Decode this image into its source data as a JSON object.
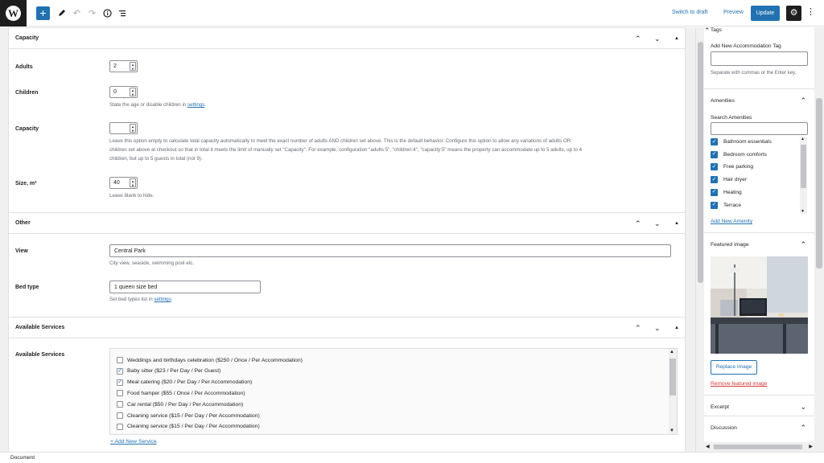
{
  "toolbar": {
    "add_block": "+",
    "switch_to_draft": "Switch to draft",
    "preview": "Preview",
    "update": "Update",
    "icons": [
      "wordpress-logo",
      "plus-icon",
      "pencil-icon",
      "undo-icon",
      "redo-icon",
      "info-icon",
      "list-view-icon",
      "gear-icon",
      "more-vertical-icon"
    ]
  },
  "capacity_section": {
    "title": "Capacity",
    "fields": {
      "adults_label": "Adults",
      "adults_value": "2",
      "children_label": "Children",
      "children_value": "0",
      "children_help_prefix": "State the age or disable children in",
      "children_help_link": "settings",
      "children_help_suffix": ".",
      "capacity_label": "Capacity",
      "capacity_value": "",
      "capacity_help_line1": "Leave this option empty to calculate total capacity automatically to meet the exact number of adults AND children set above. This is the default behavior. Configure this option to allow any variations of adults OR",
      "capacity_help_line2": "children set above at checkout so that in total it meets the limit of manually set \"Capacity\". For example, configuration \"adults:5\", \"children:4\", \"capacity:5\" means the property can accommodate up to 5 adults, up to 4",
      "capacity_help_line3": "children, but up to 5 guests in total (not 9).",
      "size_label": "Size, m²",
      "size_value": "40",
      "size_help": "Leave blank to hide."
    }
  },
  "other_section": {
    "title": "Other",
    "view_label": "View",
    "view_value": "Central Park",
    "view_help": "City view, seaside, swimming pool etc.",
    "bed_label": "Bed type",
    "bed_value": "1 queen size bed",
    "bed_help_prefix": "Set bed types list in",
    "bed_help_link": "settings",
    "bed_help_suffix": "."
  },
  "services_section": {
    "title": "Available Services",
    "label": "Available Services",
    "items": [
      {
        "label": "Weddings and birthdays celebration ($250 / Once / Per Accommodation)",
        "checked": false
      },
      {
        "label": "Baby sitter ($23 / Per Day / Per Guest)",
        "checked": true
      },
      {
        "label": "Meal catering ($20 / Per Day / Per Accommodation)",
        "checked": true
      },
      {
        "label": "Food hamper ($55 / Once / Per Accommodation)",
        "checked": false
      },
      {
        "label": "Car rental ($50 / Per Day / Per Accommodation)",
        "checked": false
      },
      {
        "label": "Cleaning service ($15 / Per Day / Per Accommodation)",
        "checked": false
      },
      {
        "label": "Cleaning service ($15 / Per Day / Per Accommodation)",
        "checked": false
      }
    ],
    "add_new": "+ Add New Service"
  },
  "sidebar": {
    "tags": {
      "title": "Tags",
      "add_label": "Add New Accommodation Tag",
      "input_value": "",
      "help": "Separate with commas or the Enter key."
    },
    "amenities": {
      "title": "Amenities",
      "search_label": "Search Amenities",
      "search_value": "",
      "items": [
        {
          "label": "Bathroom essentials",
          "checked": true
        },
        {
          "label": "Bedroom comforts",
          "checked": true
        },
        {
          "label": "Free parking",
          "checked": true
        },
        {
          "label": "Hair dryer",
          "checked": true
        },
        {
          "label": "Heating",
          "checked": true
        },
        {
          "label": "Terrace",
          "checked": true
        }
      ],
      "add_new": "Add New Amenity"
    },
    "featured_image": {
      "title": "Featured image",
      "replace": "Replace Image",
      "remove": "Remove featured image"
    },
    "excerpt": {
      "title": "Excerpt"
    },
    "discussion": {
      "title": "Discussion"
    }
  },
  "footer": {
    "breadcrumb": "Document"
  },
  "colors": {
    "accent": "#2271b1",
    "danger": "#d63638",
    "dark": "#1e1e1e"
  }
}
